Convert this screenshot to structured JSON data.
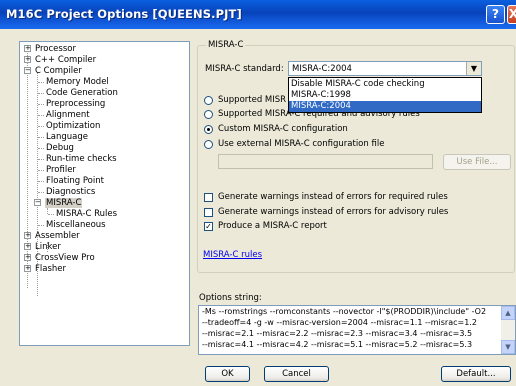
{
  "window": {
    "title": "M16C Project Options [QUEENS.PJT]",
    "help_glyph": "?",
    "close_glyph": "X"
  },
  "tree": {
    "items": [
      {
        "label": "Processor",
        "expander": "+"
      },
      {
        "label": "C++ Compiler",
        "expander": "+"
      },
      {
        "label": "C Compiler",
        "expander": "−"
      },
      {
        "label": "Memory Model"
      },
      {
        "label": "Code Generation"
      },
      {
        "label": "Preprocessing"
      },
      {
        "label": "Alignment"
      },
      {
        "label": "Optimization"
      },
      {
        "label": "Language"
      },
      {
        "label": "Debug"
      },
      {
        "label": "Run-time checks"
      },
      {
        "label": "Profiler"
      },
      {
        "label": "Floating Point"
      },
      {
        "label": "Diagnostics"
      },
      {
        "label": "MISRA-C",
        "expander": "−"
      },
      {
        "label": "MISRA-C Rules"
      },
      {
        "label": "Miscellaneous"
      },
      {
        "label": "Assembler",
        "expander": "+"
      },
      {
        "label": "Linker",
        "expander": "+"
      },
      {
        "label": "CrossView Pro",
        "expander": "+"
      },
      {
        "label": "Flasher",
        "expander": "+"
      }
    ]
  },
  "misra": {
    "group_label": "MISRA-C",
    "standard_label": "MISRA-C standard:",
    "standard_value": "MISRA-C:2004",
    "dropdown_options": [
      "Disable MISRA-C code checking",
      "MISRA-C:1998",
      "MISRA-C:2004"
    ],
    "radio1_label": "Supported MISR",
    "radio2_label": "Supported MISRA-C required and advisory rules",
    "radio3_label": "Custom MISRA-C configuration",
    "radio4_label": "Use external MISRA-C configuration file",
    "use_file_button": "Use File...",
    "check1_label": "Generate warnings instead of errors for required rules",
    "check2_label": "Generate warnings instead of errors for advisory rules",
    "check3_label": "Produce a MISRA-C report",
    "rules_link": "MISRA-C rules"
  },
  "options": {
    "label": "Options string:",
    "lines": [
      "-Ms --romstrings --romconstants --novector -I\"$(PRODDIR)\\include\" -O2",
      "--tradeoff=4 -g -w --misrac-version=2004 --misrac=1.1 --misrac=1.2",
      "--misrac=2.1 --misrac=2.2 --misrac=2.3 --misrac=3.4 --misrac=3.5",
      "--misrac=4.1 --misrac=4.2 --misrac=5.1 --misrac=5.2 --misrac=5.3"
    ]
  },
  "buttons": {
    "ok": "OK",
    "cancel": "Cancel",
    "default": "Default..."
  }
}
